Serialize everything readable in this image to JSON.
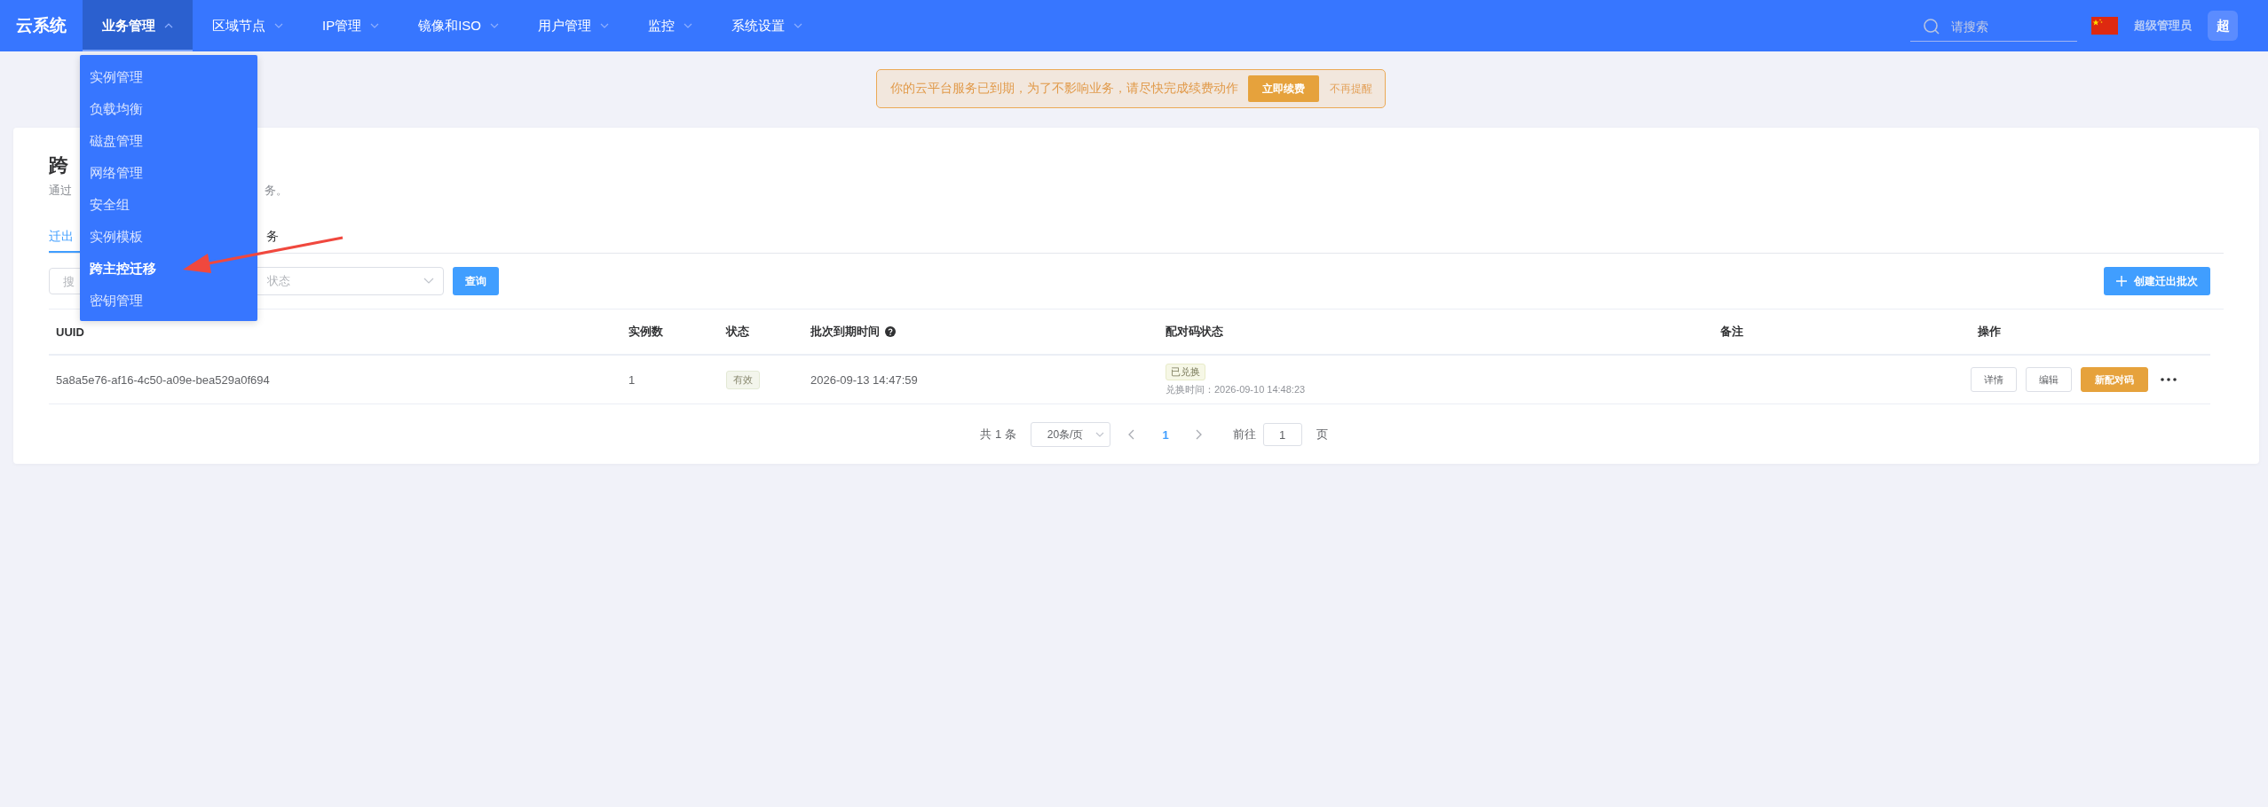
{
  "nav": {
    "brand": "云系统",
    "items": [
      {
        "label": "业务管理",
        "selected": true,
        "expanded": true
      },
      {
        "label": "区域节点",
        "selected": false,
        "expanded": false
      },
      {
        "label": "IP管理",
        "selected": false,
        "expanded": false
      },
      {
        "label": "镜像和ISO",
        "selected": false,
        "expanded": false
      },
      {
        "label": "用户管理",
        "selected": false,
        "expanded": false
      },
      {
        "label": "监控",
        "selected": false,
        "expanded": false
      },
      {
        "label": "系统设置",
        "selected": false,
        "expanded": false
      }
    ]
  },
  "dropdown": {
    "items": [
      {
        "label": "实例管理",
        "selected": false
      },
      {
        "label": "负载均衡",
        "selected": false
      },
      {
        "label": "磁盘管理",
        "selected": false
      },
      {
        "label": "网络管理",
        "selected": false
      },
      {
        "label": "安全组",
        "selected": false
      },
      {
        "label": "实例模板",
        "selected": false
      },
      {
        "label": "跨主控迁移",
        "selected": true
      },
      {
        "label": "密钥管理",
        "selected": false
      }
    ]
  },
  "header_right": {
    "search_placeholder": "请搜索",
    "user": "超级管理员",
    "avatar": "超"
  },
  "notice": {
    "message": "你的云平台服务已到期，为了不影响业务，请尽快完成续费动作",
    "action": "立即续费",
    "dismiss": "不再提醒"
  },
  "page": {
    "title": "跨",
    "description_start": "通过",
    "description_end": "务。"
  },
  "tabs": [
    {
      "label": "迁出",
      "selected": true
    },
    {
      "label": "务",
      "selected": false
    }
  ],
  "filters": {
    "search_placeholder": "搜",
    "status_placeholder": "状态",
    "query": "查询",
    "create": "创建迁出批次"
  },
  "table": {
    "columns": [
      "UUID",
      "实例数",
      "状态",
      "批次到期时间",
      "配对码状态",
      "备注",
      "操作"
    ],
    "rows": [
      {
        "uuid": "5a8a5e76-af16-4c50-a09e-bea529a0f694",
        "count": "1",
        "status": "有效",
        "expires": "2026-09-13 14:47:59",
        "pair_status": "已兑换",
        "pair_time": "兑换时间：2026-09-10 14:48:23",
        "actions": [
          {
            "label": "详情",
            "kind": "plain"
          },
          {
            "label": "编辑",
            "kind": "plain"
          },
          {
            "label": "新配对码",
            "kind": "warning"
          }
        ]
      }
    ]
  },
  "pagination": {
    "total": "共 1 条",
    "page_size": "20条/页",
    "pages": [
      {
        "label": "1",
        "selected": true
      }
    ],
    "goto": "前往",
    "goto_value": "1",
    "page_unit": "页"
  }
}
